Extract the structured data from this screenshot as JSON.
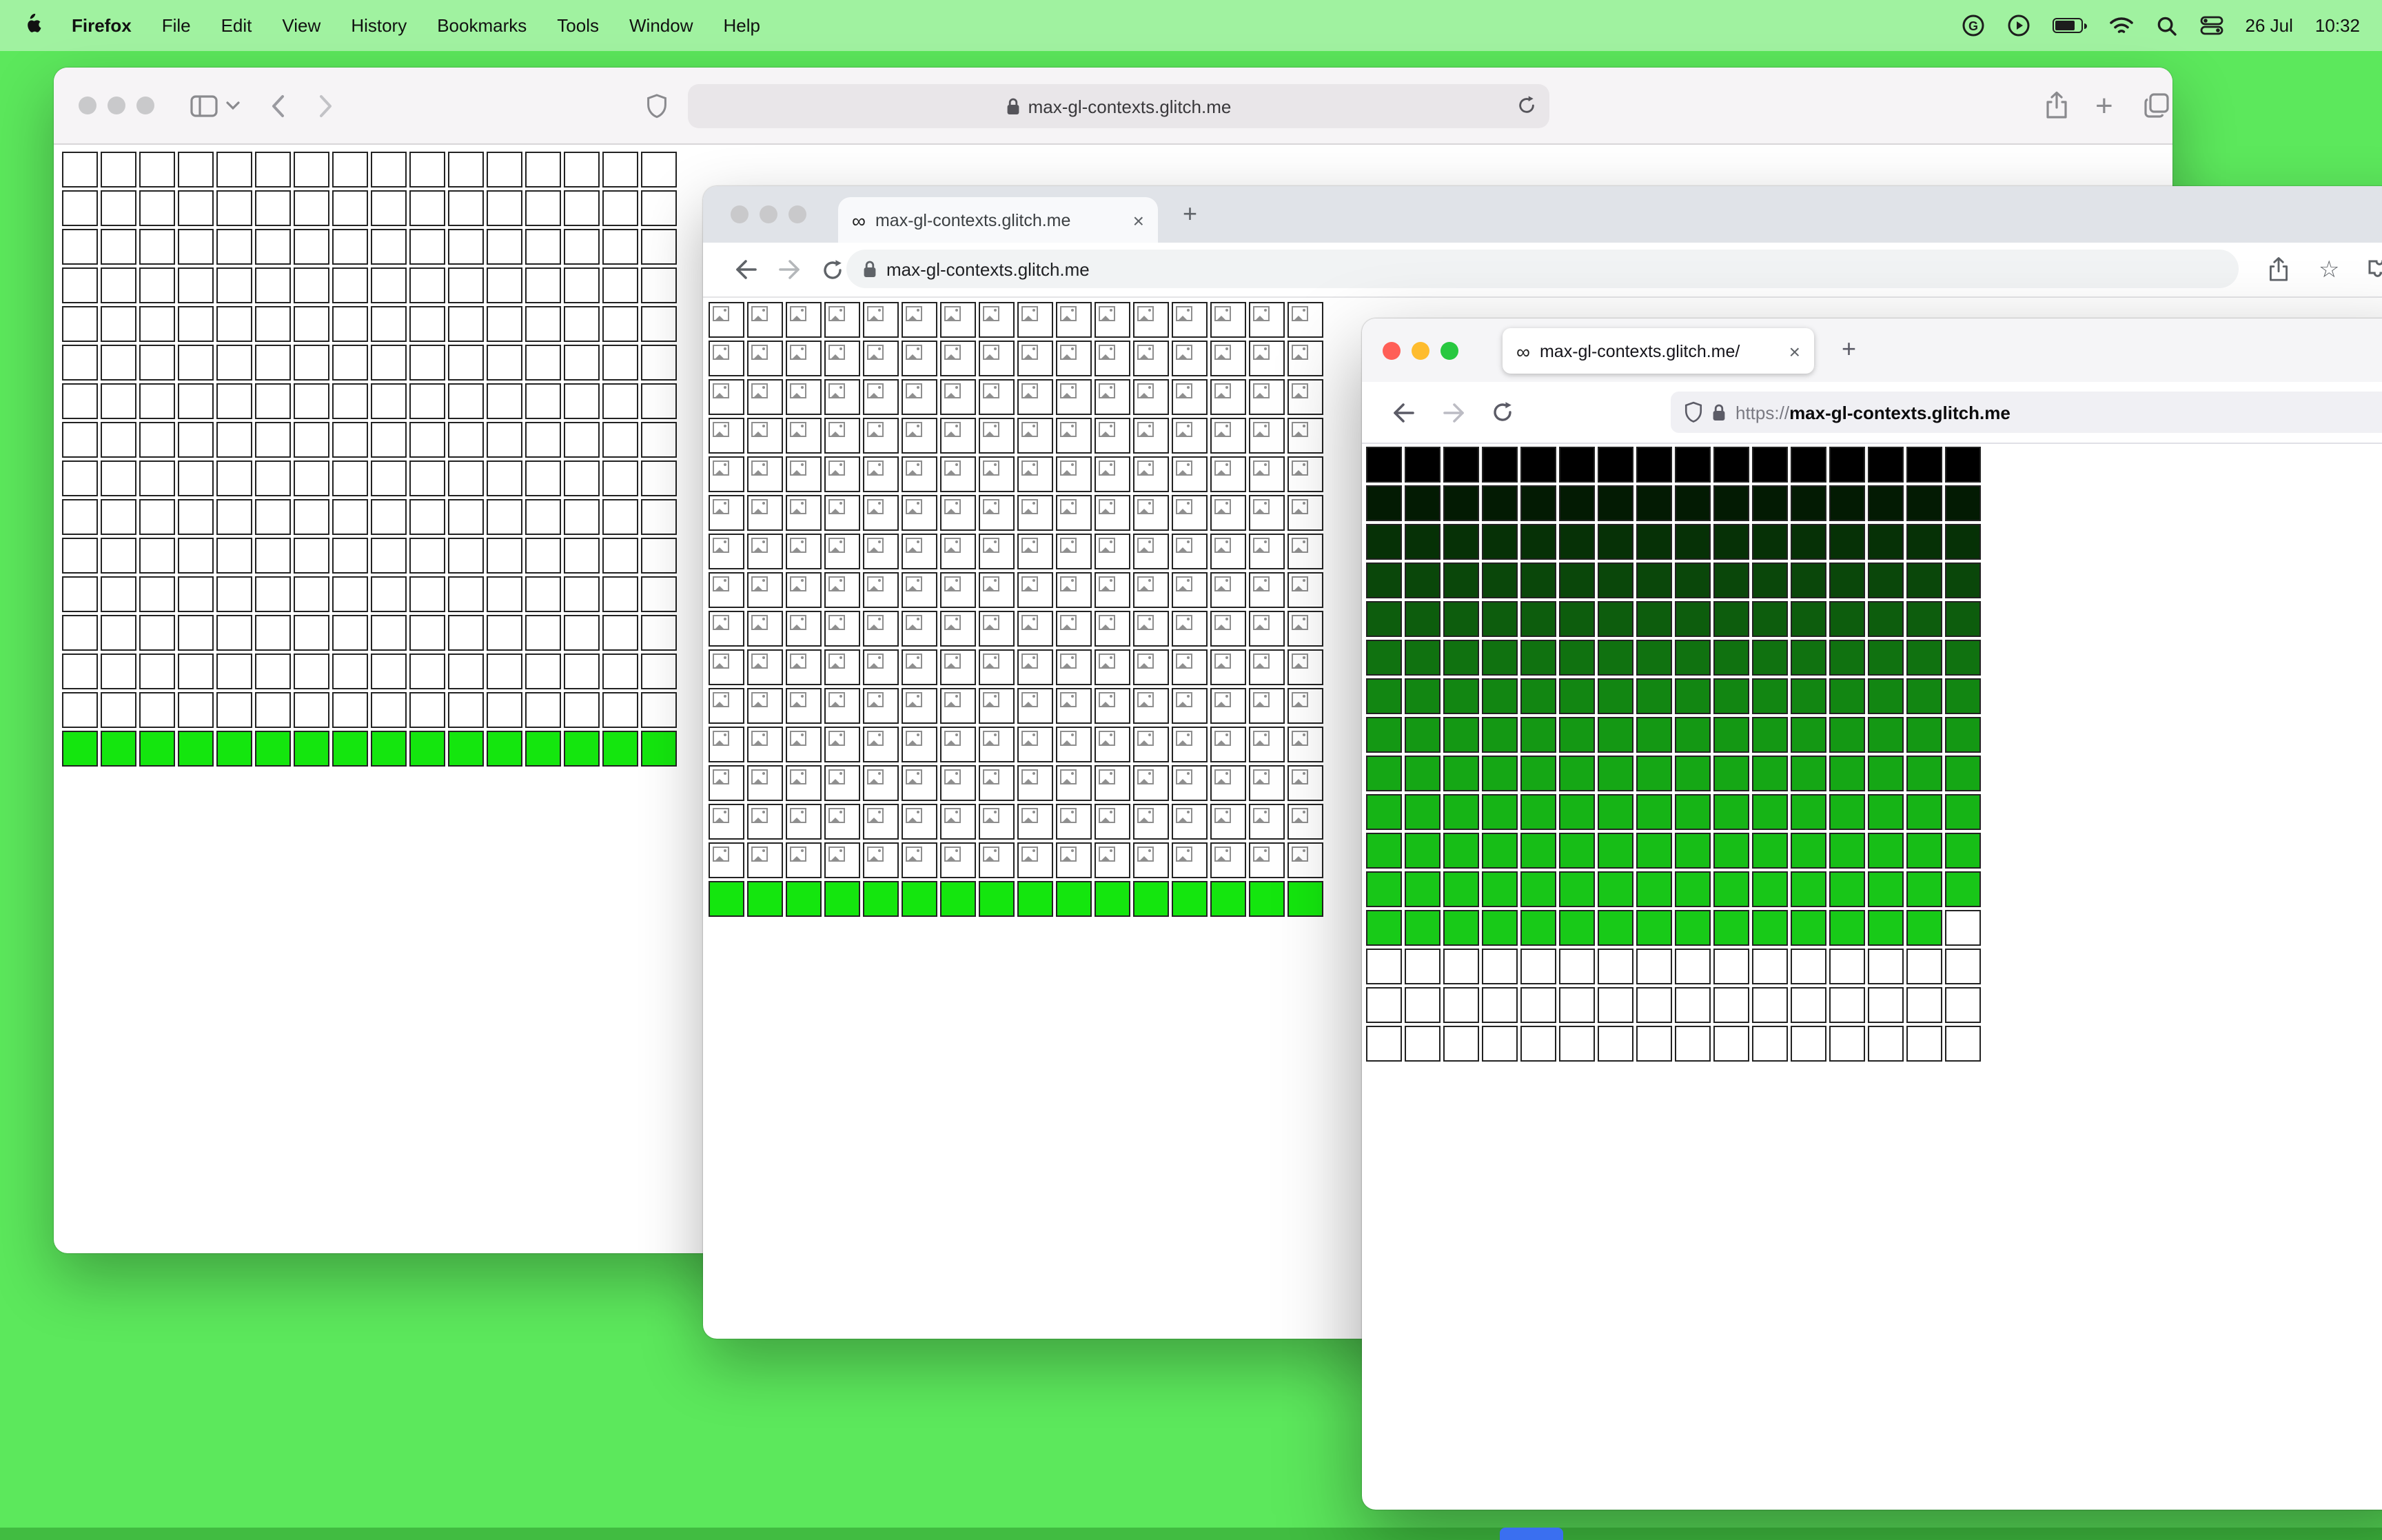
{
  "desktop": {
    "background": "#5ce85c"
  },
  "menubar": {
    "app_name": "Firefox",
    "menus": [
      "File",
      "Edit",
      "View",
      "History",
      "Bookmarks",
      "Tools",
      "Window",
      "Help"
    ],
    "status": {
      "date": "26 Jul",
      "time": "10:32"
    }
  },
  "glyphs": {
    "plus": "+",
    "close": "×",
    "g_badge": "G",
    "play": "▶"
  },
  "safari_window": {
    "url": "max-gl-contexts.glitch.me",
    "grid": {
      "cols": 16,
      "rows": [
        {
          "color": "#ffffff",
          "count": 15
        },
        {
          "color": "#14e60e",
          "count": 1
        }
      ]
    }
  },
  "chrome_window": {
    "tab": {
      "favicon": "∞",
      "title": "max-gl-contexts.glitch.me"
    },
    "url": "max-gl-contexts.glitch.me",
    "grid": {
      "cols": 16,
      "rows": [
        {
          "color": "#ffffff",
          "count": 15,
          "icon": "broken-image"
        },
        {
          "color": "#14e60e",
          "count": 1
        }
      ]
    }
  },
  "firefox_window": {
    "tab": {
      "favicon": "∞",
      "title": "max-gl-contexts.glitch.me/"
    },
    "url_scheme": "https://",
    "url_host": "max-gl-contexts.glitch.me",
    "grid": {
      "cols": 16,
      "rows": [
        {
          "color": "#000000",
          "count": 1
        },
        {
          "color": "#031b03",
          "count": 1
        },
        {
          "color": "#063106",
          "count": 1
        },
        {
          "color": "#0a470a",
          "count": 1
        },
        {
          "color": "#0d5d0d",
          "count": 1
        },
        {
          "color": "#107210",
          "count": 1
        },
        {
          "color": "#128612",
          "count": 1
        },
        {
          "color": "#149814",
          "count": 1
        },
        {
          "color": "#15a715",
          "count": 1
        },
        {
          "color": "#16b416",
          "count": 1
        },
        {
          "color": "#17be17",
          "count": 1
        },
        {
          "color": "#18c618",
          "count": 1
        },
        {
          "color": "#18ca18",
          "count": 1,
          "last_cell_color": "#ffffff"
        },
        {
          "color": "#ffffff",
          "count": 3
        }
      ]
    }
  }
}
